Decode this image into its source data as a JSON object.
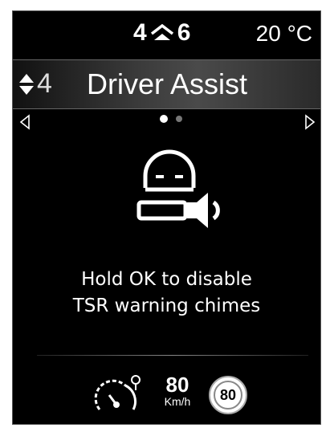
{
  "status": {
    "gear_current": "4",
    "gear_suggested": "6",
    "temperature": "20 °C",
    "shift_up_icon": "shift-up-icon"
  },
  "menu": {
    "index": "4",
    "title": "Driver Assist",
    "nav_left_icon": "triangle-left-icon",
    "nav_right_icon": "triangle-right-icon",
    "page_count": 2,
    "active_page": 1
  },
  "content": {
    "icon": "driver-chime-icon",
    "message_line1": "Hold OK to disable",
    "message_line2": "TSR warning chimes"
  },
  "bottom": {
    "limiter_icon": "speed-limiter-icon",
    "set_speed": "80",
    "speed_unit": "Km/h",
    "sign_speed": "80"
  }
}
